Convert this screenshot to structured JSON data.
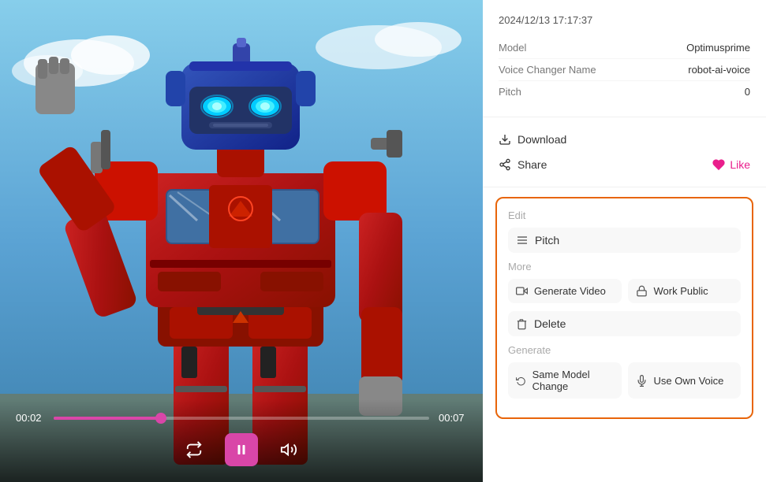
{
  "media": {
    "current_time": "00:02",
    "total_time": "00:07",
    "progress_percent": 28.57
  },
  "info": {
    "timestamp": "2024/12/13 17:17:37",
    "model_label": "Model",
    "model_value": "Optimusprime",
    "voice_changer_label": "Voice Changer Name",
    "voice_changer_value": "robot-ai-voice",
    "pitch_label": "Pitch",
    "pitch_value": "0"
  },
  "actions": {
    "download_label": "Download",
    "share_label": "Share",
    "like_label": "Like"
  },
  "edit_section": {
    "title": "Edit",
    "pitch_label": "Pitch",
    "more_title": "More",
    "generate_video_label": "Generate Video",
    "work_public_label": "Work Public",
    "delete_label": "Delete",
    "generate_title": "Generate",
    "same_model_label": "Same Model Change",
    "use_own_voice_label": "Use Own Voice"
  },
  "controls": {
    "repeat_icon": "↻",
    "play_icon": "▐▐",
    "volume_icon": "🔊"
  }
}
